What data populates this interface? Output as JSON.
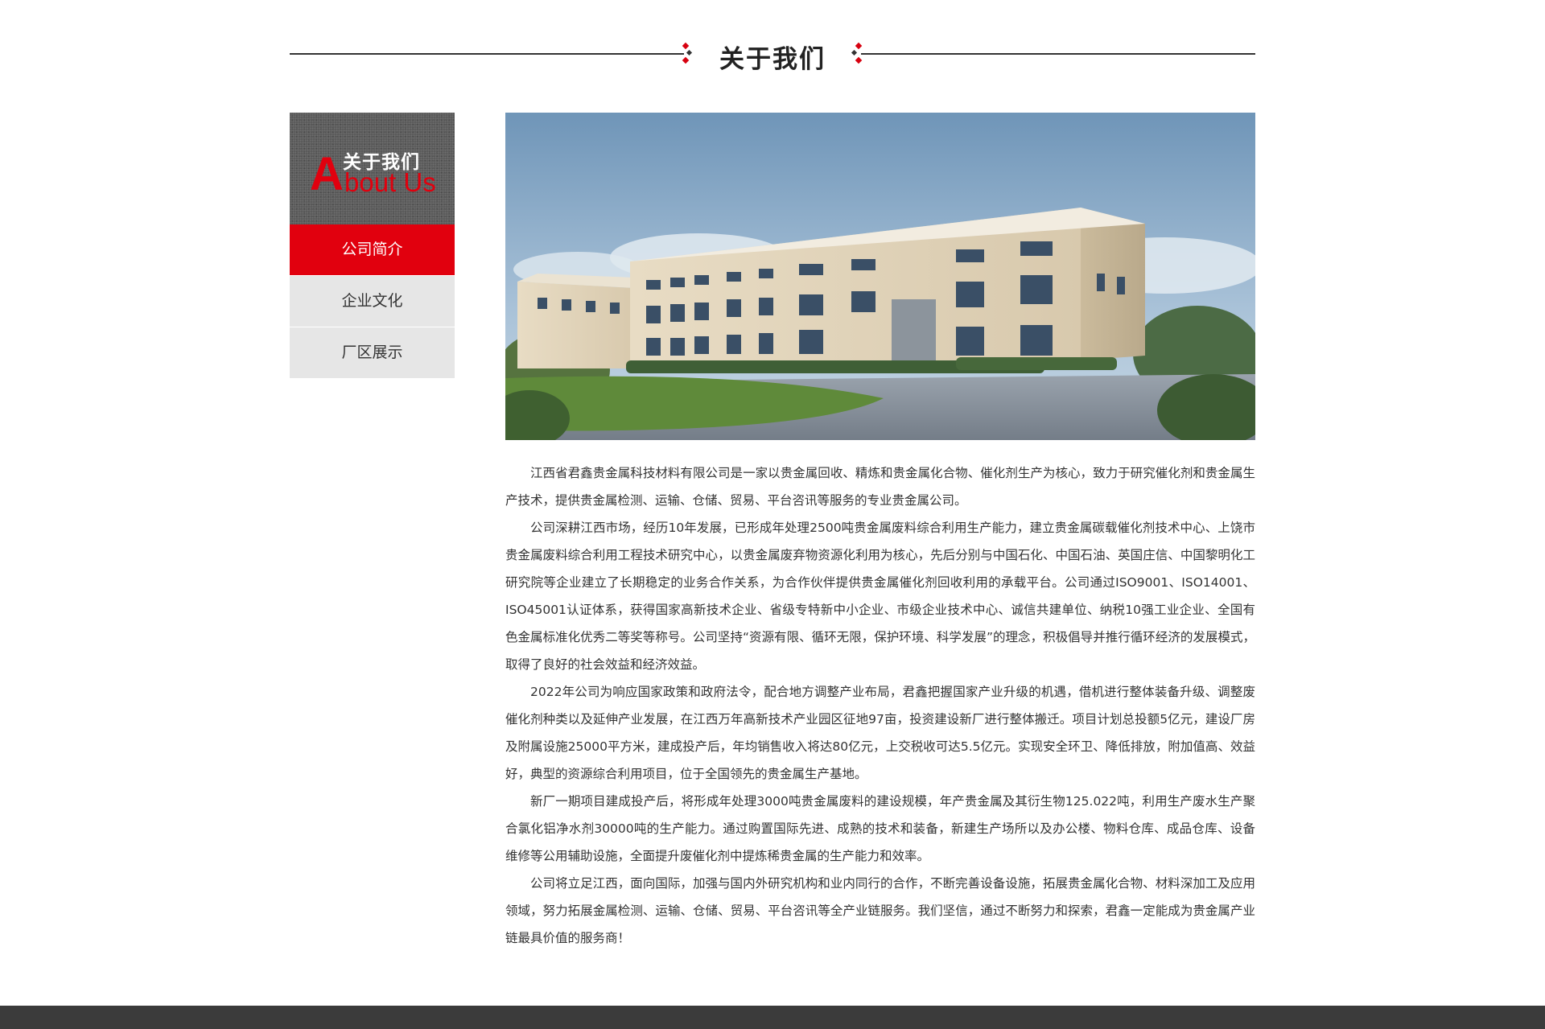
{
  "section": {
    "title": "关于我们"
  },
  "sidebar": {
    "head_cn": "关于我们",
    "head_en_initial": "A",
    "head_en_rest": "bout Us",
    "items": [
      {
        "label": "公司简介",
        "active": true
      },
      {
        "label": "企业文化",
        "active": false
      },
      {
        "label": "厂区展示",
        "active": false
      }
    ]
  },
  "content": {
    "paragraphs": [
      "江西省君鑫贵金属科技材料有限公司是一家以贵金属回收、精炼和贵金属化合物、催化剂生产为核心，致力于研究催化剂和贵金属生产技术，提供贵金属检测、运输、仓储、贸易、平台咨讯等服务的专业贵金属公司。",
      "公司深耕江西市场，经历10年发展，已形成年处理2500吨贵金属废料综合利用生产能力，建立贵金属碳载催化剂技术中心、上饶市贵金属废料综合利用工程技术研究中心，以贵金属废弃物资源化利用为核心，先后分别与中国石化、中国石油、英国庄信、中国黎明化工研究院等企业建立了长期稳定的业务合作关系，为合作伙伴提供贵金属催化剂回收利用的承载平台。公司通过ISO9001、ISO14001、ISO45001认证体系，获得国家高新技术企业、省级专特新中小企业、市级企业技术中心、诚信共建单位、纳税10强工业企业、全国有色金属标准化优秀二等奖等称号。公司坚持“资源有限、循环无限，保护环境、科学发展”的理念，积极倡导并推行循环经济的发展模式，取得了良好的社会效益和经济效益。",
      "2022年公司为响应国家政策和政府法令，配合地方调整产业布局，君鑫把握国家产业升级的机遇，借机进行整体装备升级、调整废催化剂种类以及延伸产业发展，在江西万年高新技术产业园区征地97亩，投资建设新厂进行整体搬迁。项目计划总投额5亿元，建设厂房及附属设施25000平方米，建成投产后，年均销售收入将达80亿元，上交税收可达5.5亿元。实现安全环卫、降低排放，附加值高、效益好，典型的资源综合利用项目，位于全国领先的贵金属生产基地。",
      "新厂一期项目建成投产后，将形成年处理3000吨贵金属废料的建设规模，年产贵金属及其衍生物125.022吨，利用生产废水生产聚合氯化铝净水剂30000吨的生产能力。通过购置国际先进、成熟的技术和装备，新建生产场所以及办公楼、物料仓库、成品仓库、设备维修等公用辅助设施，全面提升废催化剂中提炼稀贵金属的生产能力和效率。",
      "公司将立足江西，面向国际，加强与国内外研究机构和业内同行的合作，不断完善设备设施，拓展贵金属化合物、材料深加工及应用领域，努力拓展金属检测、运输、仓储、贸易、平台咨讯等全产业链服务。我们坚信，通过不断努力和探索，君鑫一定能成为贵金属产业链最具价值的服务商！"
    ]
  },
  "colors": {
    "accent": "#e1000e",
    "nav_inactive_bg": "#e6e6e6",
    "footer_bg": "#3b3b3b"
  }
}
